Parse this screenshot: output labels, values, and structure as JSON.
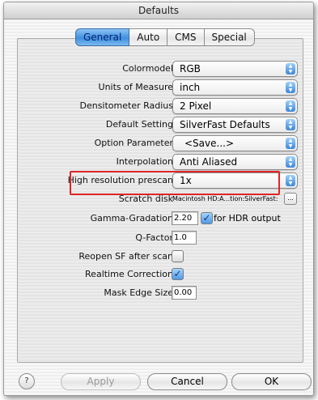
{
  "window": {
    "title": "Defaults"
  },
  "tabs": [
    {
      "label": "General",
      "active": true
    },
    {
      "label": "Auto",
      "active": false
    },
    {
      "label": "CMS",
      "active": false
    },
    {
      "label": "Special",
      "active": false
    }
  ],
  "settings": {
    "colormodel": {
      "label": "Colormodel",
      "value": "RGB"
    },
    "units": {
      "label": "Units of Measure",
      "value": "inch"
    },
    "densitometer": {
      "label": "Densitometer Radius",
      "value": "2 Pixel"
    },
    "default_setting": {
      "label": "Default Setting",
      "value": "SilverFast Defaults"
    },
    "option_parameter": {
      "label": "Option Parameter",
      "value": "<Save...>"
    },
    "interpolation": {
      "label": "Interpolation",
      "value": "Anti Aliased"
    },
    "highres_prescan": {
      "label": "High resolution prescan",
      "value": "1x"
    },
    "scratch_disk": {
      "label": "Scratch disk",
      "value": "Macintosh HD:A...tion:SilverFast:",
      "browse_label": "..."
    },
    "gamma": {
      "label": "Gamma-Gradation",
      "value": "2.20",
      "hdr_label": "for HDR output",
      "hdr_checked": true
    },
    "q_factor": {
      "label": "Q-Factor",
      "value": "1.0"
    },
    "reopen": {
      "label": "Reopen SF after scan",
      "checked": false
    },
    "realtime": {
      "label": "Realtime Correction",
      "checked": true
    },
    "mask_edge": {
      "label": "Mask Edge Size",
      "value": "0.00"
    }
  },
  "footer": {
    "help_label": "?",
    "apply_label": "Apply",
    "cancel_label": "Cancel",
    "ok_label": "OK"
  },
  "colors": {
    "highlight": "#e02525",
    "tab_active": "#3f8fe0"
  }
}
